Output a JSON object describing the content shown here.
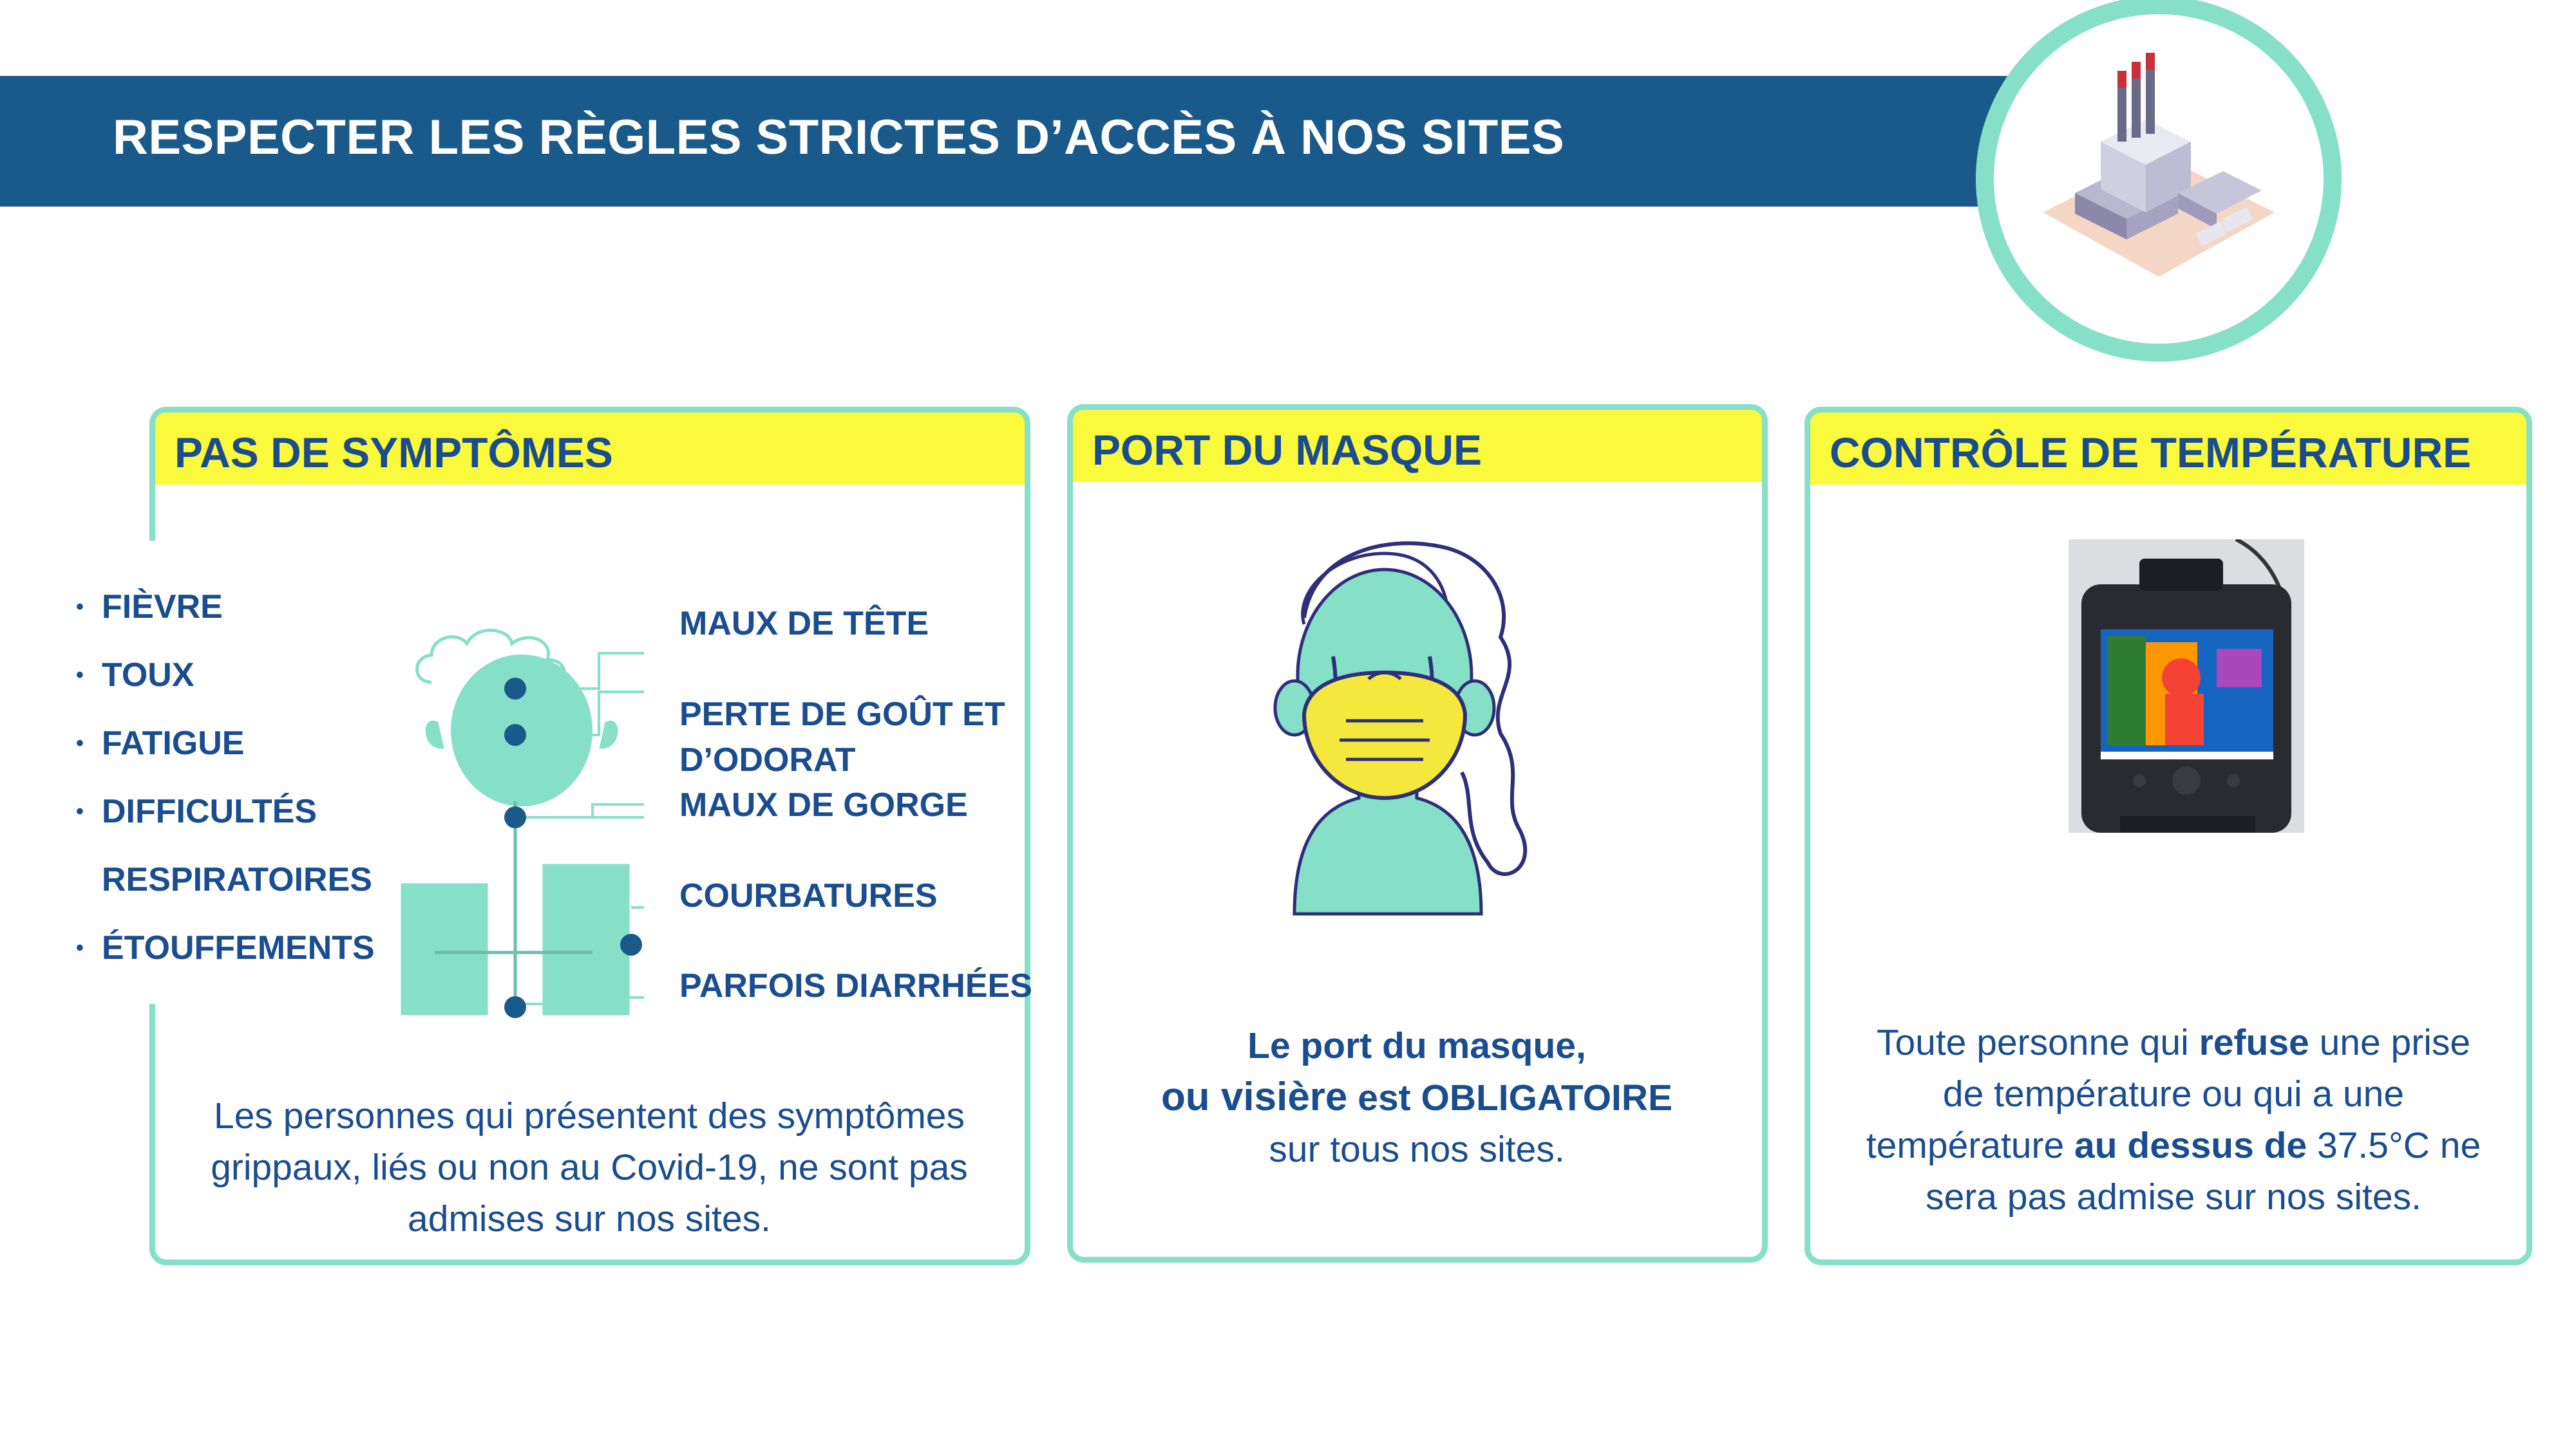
{
  "banner": {
    "title": "RESPECTER LES RÈGLES STRICTES D’ACCÈS À NOS SITES"
  },
  "colors": {
    "banner": "#1a5a8a",
    "card_border": "#86dfc7",
    "card_header": "#fbf93c",
    "text": "#1a4d8f",
    "figure": "#86dfc7"
  },
  "factory_icon": "factory-icon",
  "cards": {
    "symptoms": {
      "title": "PAS DE SYMPTÔMES",
      "bullets": [
        "FIÈVRE",
        "TOUX",
        "FATIGUE",
        "DIFFICULTÉS",
        "RESPIRATOIRES",
        "ÉTOUFFEMENTS"
      ],
      "labels": {
        "headache": "MAUX  DE TÊTE",
        "taste_smell_1": "PERTE DE GOÛT ET",
        "taste_smell_2": "D’ODORAT",
        "throat": "MAUX DE GORGE",
        "aches": "COURBATURES",
        "diarrhea": "PARFOIS DIARRHÉES"
      },
      "body": {
        "line1": "Les personnes qui présentent des symptômes",
        "line2": "grippaux, liés ou non au Covid-19, ne sont pas",
        "line3": "admises sur nos sites."
      }
    },
    "mask": {
      "title": "PORT DU MASQUE",
      "body": {
        "line1": "Le port du masque,",
        "line2_a": "ou visière",
        "line2_b": " est OBLIGATOIRE",
        "line3": "sur tous nos sites."
      }
    },
    "temperature": {
      "title": "CONTRÔLE DE TEMPÉRATURE",
      "body": {
        "l1": "Toute personne qui ",
        "l1_bold": "refuse",
        "l1_end": " une prise",
        "l2": "de température ou qui a une",
        "l3": "température ",
        "l3_bold": "au dessus de",
        "l3_end": "  37.5°C ne",
        "l4": "sera pas admise sur nos sites."
      }
    }
  }
}
